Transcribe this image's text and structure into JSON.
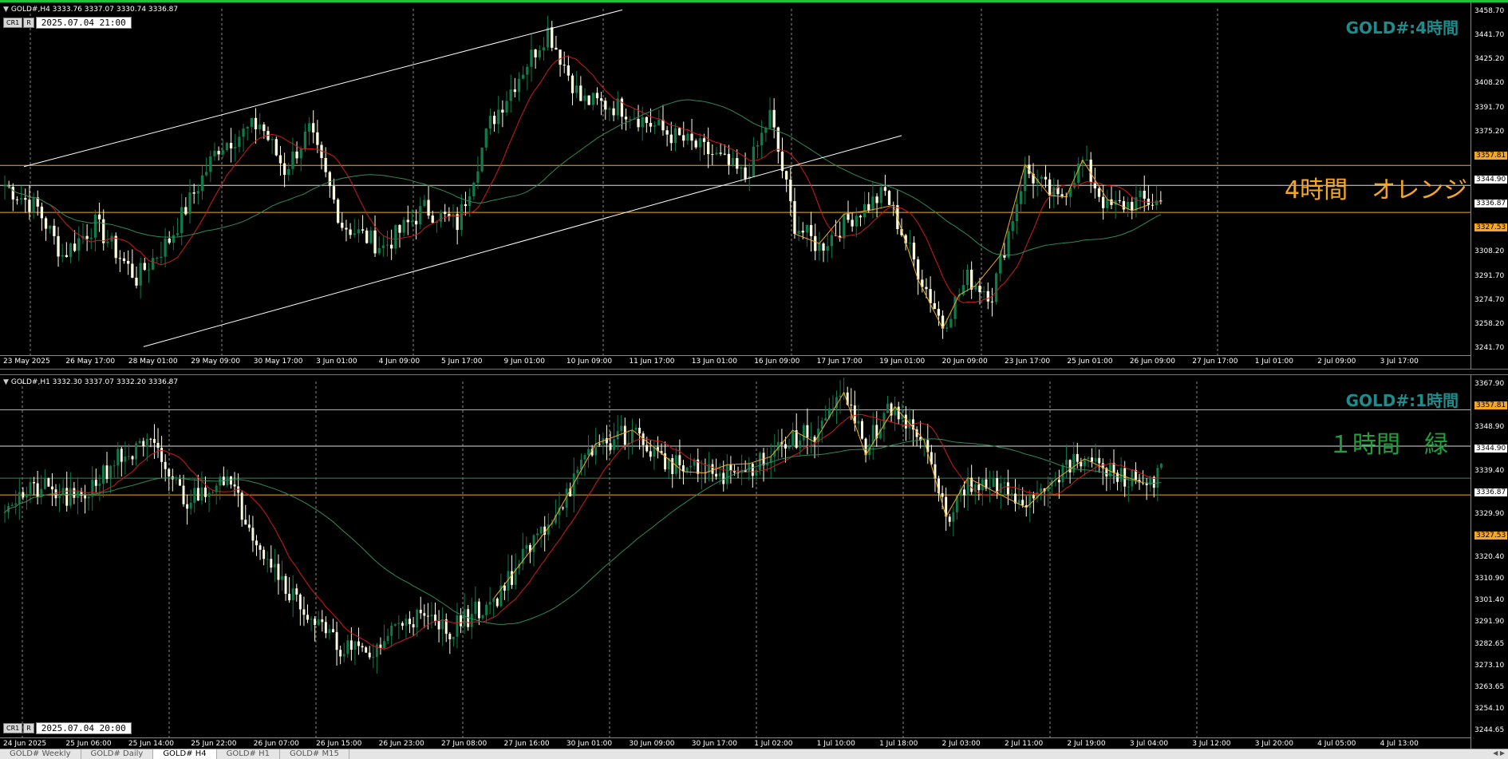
{
  "pane_h4": {
    "header": "GOLD#,H4  3333.76 3337.07 3330.74 3336.87",
    "time_label": "2025.07.04 21:00",
    "cr_label": "CR1",
    "r_label": "R",
    "title": "GOLD#:4時間",
    "overlay": "4時間　オレンジ",
    "price_ticks": [
      "3458.70",
      "3441.70",
      "3425.20",
      "3408.20",
      "3391.70",
      "3375.20",
      "3357.81",
      "3344.90",
      "3336.87",
      "3327.53",
      "3308.20",
      "3291.70",
      "3274.70",
      "3258.20",
      "3241.70"
    ],
    "time_ticks": [
      "23 May 2025",
      "26 May 17:00",
      "28 May 01:00",
      "29 May 09:00",
      "30 May 17:00",
      "3 Jun 01:00",
      "4 Jun 09:00",
      "5 Jun 17:00",
      "9 Jun 01:00",
      "10 Jun 09:00",
      "11 Jun 17:00",
      "13 Jun 01:00",
      "16 Jun 09:00",
      "17 Jun 17:00",
      "19 Jun 01:00",
      "20 Jun 09:00",
      "23 Jun 17:00",
      "25 Jun 01:00",
      "26 Jun 09:00",
      "27 Jun 17:00",
      "1 Jul 01:00",
      "2 Jul 09:00",
      "3 Jul 17:00"
    ]
  },
  "pane_h1": {
    "header": "GOLD#,H1  3332.30 3337.07 3332.20 3336.87",
    "time_label": "2025.07.04 20:00",
    "cr_label": "CR1",
    "r_label": "R",
    "title": "GOLD#:1時間",
    "overlay": "１時間　緑",
    "price_ticks": [
      "3367.90",
      "3357.81",
      "3348.90",
      "3344.90",
      "3339.40",
      "3336.87",
      "3329.90",
      "3327.53",
      "3320.40",
      "3310.90",
      "3301.40",
      "3291.90",
      "3282.65",
      "3273.10",
      "3263.65",
      "3254.10",
      "3244.65"
    ],
    "time_ticks": [
      "24 Jun 2025",
      "25 Jun 06:00",
      "25 Jun 14:00",
      "25 Jun 22:00",
      "26 Jun 07:00",
      "26 Jun 15:00",
      "26 Jun 23:00",
      "27 Jun 08:00",
      "27 Jun 16:00",
      "30 Jun 01:00",
      "30 Jun 09:00",
      "30 Jun 17:00",
      "1 Jul 02:00",
      "1 Jul 10:00",
      "1 Jul 18:00",
      "2 Jul 03:00",
      "2 Jul 11:00",
      "2 Jul 19:00",
      "3 Jul 04:00",
      "3 Jul 12:00",
      "3 Jul 20:00",
      "4 Jul 05:00",
      "4 Jul 13:00"
    ]
  },
  "tabs": [
    "GOLD# Weekly",
    "GOLD# Daily",
    "GOLD# H4",
    "GOLD# H1",
    "GOLD# M15"
  ],
  "active_tab": 2,
  "colors": {
    "bull": "#0f7a4a",
    "bear": "#ffffe0",
    "ma_fast": "#d11a1a",
    "ma_slow": "#2e8b57",
    "level": "#f5a623",
    "title": "#1f8b8b",
    "overlay_h4": "#f5a623",
    "overlay_h1": "#1fa03a"
  }
}
